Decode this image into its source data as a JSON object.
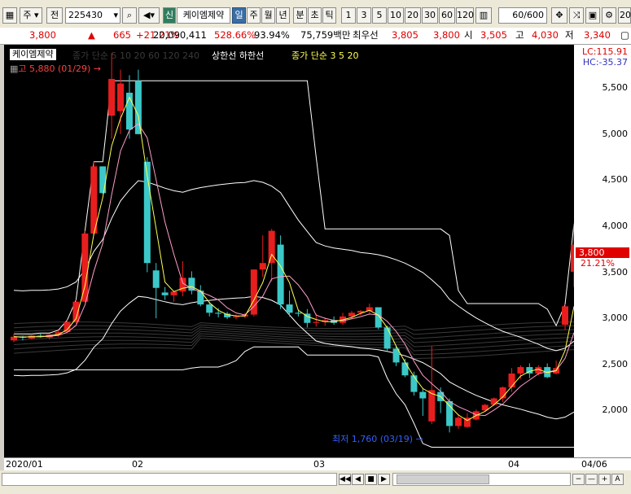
{
  "toolbar": {
    "market": "주",
    "prev_label": "전",
    "code": "225430",
    "badge": "신",
    "name": "케이엠제약",
    "periods": [
      "일",
      "주",
      "월",
      "년",
      "분",
      "초",
      "틱"
    ],
    "active_period": "일",
    "intervals": [
      "1",
      "3",
      "5",
      "10",
      "20",
      "30",
      "60",
      "120"
    ],
    "count": "60",
    "count_total": "/600",
    "right_label": "20"
  },
  "info": {
    "price": "3,800",
    "change": "665",
    "change_pct": "+21.21%",
    "volume": "20,090,411",
    "vol_ratio": "528.66%",
    "ratio": "93.94%",
    "amount": "75,759백만",
    "bid_label": "최우선",
    "bid": "3,805",
    "ask": "3,800",
    "open_label": "시",
    "open": "3,505",
    "high_label": "고",
    "high": "4,030",
    "low_label": "저",
    "low": "3,340"
  },
  "chart": {
    "legend_name": "케이엠제약",
    "legend_faint": "종가 단순 5  10  20  60  120  240",
    "legend_bands": "상한선  하한선",
    "legend_ma": "종가 단순 3  5  20",
    "high_marker": "고 5,880 (01/29)",
    "low_marker": "최저 1,760 (03/19)",
    "lc": "LC:115.91",
    "hc": "HC:-35.37",
    "current_price": "3,800",
    "current_pct": "21.21%"
  },
  "colors": {
    "up": "#e81e1e",
    "down": "#3cc8c8",
    "ma3": "#ffff50",
    "ma5": "#ff9ec8",
    "band": "#ffffff"
  },
  "chart_data": {
    "type": "candlestick",
    "y_ticks": [
      "5,500",
      "5,000",
      "4,500",
      "4,000",
      "3,500",
      "3,000",
      "2,500",
      "2,000"
    ],
    "x_ticks": [
      "2020/01",
      "02",
      "03",
      "04",
      "04/06"
    ],
    "candles": [
      {
        "o": 2760,
        "h": 2830,
        "l": 2740,
        "c": 2800
      },
      {
        "o": 2800,
        "h": 2810,
        "l": 2760,
        "c": 2790
      },
      {
        "o": 2780,
        "h": 2830,
        "l": 2770,
        "c": 2810
      },
      {
        "o": 2810,
        "h": 2840,
        "l": 2790,
        "c": 2800
      },
      {
        "o": 2790,
        "h": 2830,
        "l": 2770,
        "c": 2820
      },
      {
        "o": 2820,
        "h": 2870,
        "l": 2800,
        "c": 2850
      },
      {
        "o": 2850,
        "h": 2980,
        "l": 2840,
        "c": 2960
      },
      {
        "o": 2960,
        "h": 3200,
        "l": 2940,
        "c": 3180
      },
      {
        "o": 3180,
        "h": 3950,
        "l": 3170,
        "c": 3920
      },
      {
        "o": 3920,
        "h": 4700,
        "l": 3900,
        "c": 4650
      },
      {
        "o": 4650,
        "h": 4360,
        "l": 4350,
        "c": 4360
      },
      {
        "o": 5200,
        "h": 5880,
        "l": 4950,
        "c": 5600
      },
      {
        "o": 5250,
        "h": 5700,
        "l": 5000,
        "c": 5550
      },
      {
        "o": 5450,
        "h": 5640,
        "l": 4950,
        "c": 5050
      },
      {
        "o": 5580,
        "h": 5700,
        "l": 5300,
        "c": 5000
      },
      {
        "o": 4700,
        "h": 4750,
        "l": 3500,
        "c": 3600
      },
      {
        "o": 3520,
        "h": 3600,
        "l": 3000,
        "c": 3330
      },
      {
        "o": 3280,
        "h": 3340,
        "l": 3200,
        "c": 3250
      },
      {
        "o": 3250,
        "h": 3300,
        "l": 3180,
        "c": 3290
      },
      {
        "o": 3290,
        "h": 3620,
        "l": 3240,
        "c": 3440
      },
      {
        "o": 3440,
        "h": 3510,
        "l": 3260,
        "c": 3300
      },
      {
        "o": 3300,
        "h": 3360,
        "l": 3130,
        "c": 3150
      },
      {
        "o": 3150,
        "h": 3180,
        "l": 3020,
        "c": 3060
      },
      {
        "o": 3060,
        "h": 3110,
        "l": 3010,
        "c": 3050
      },
      {
        "o": 3050,
        "h": 3070,
        "l": 2990,
        "c": 3010
      },
      {
        "o": 3010,
        "h": 3040,
        "l": 2990,
        "c": 3020
      },
      {
        "o": 3020,
        "h": 3060,
        "l": 3000,
        "c": 3040
      },
      {
        "o": 3040,
        "h": 3500,
        "l": 3020,
        "c": 3530
      },
      {
        "o": 3530,
        "h": 3900,
        "l": 3450,
        "c": 3600
      },
      {
        "o": 3600,
        "h": 3970,
        "l": 3400,
        "c": 3950
      },
      {
        "o": 3800,
        "h": 3900,
        "l": 3100,
        "c": 3150
      },
      {
        "o": 3150,
        "h": 3300,
        "l": 3020,
        "c": 3060
      },
      {
        "o": 3060,
        "h": 3090,
        "l": 3020,
        "c": 3050
      },
      {
        "o": 3050,
        "h": 3100,
        "l": 2900,
        "c": 2950
      },
      {
        "o": 2950,
        "h": 3050,
        "l": 2910,
        "c": 2960
      },
      {
        "o": 2960,
        "h": 3010,
        "l": 2920,
        "c": 2980
      },
      {
        "o": 2980,
        "h": 3020,
        "l": 2930,
        "c": 2950
      },
      {
        "o": 2950,
        "h": 3060,
        "l": 2930,
        "c": 3020
      },
      {
        "o": 3020,
        "h": 3080,
        "l": 3000,
        "c": 3060
      },
      {
        "o": 3060,
        "h": 3090,
        "l": 3030,
        "c": 3080
      },
      {
        "o": 3080,
        "h": 3160,
        "l": 3040,
        "c": 3120
      },
      {
        "o": 3120,
        "h": 3100,
        "l": 2880,
        "c": 2900
      },
      {
        "o": 2900,
        "h": 2920,
        "l": 2650,
        "c": 2670
      },
      {
        "o": 2670,
        "h": 2700,
        "l": 2480,
        "c": 2520
      },
      {
        "o": 2520,
        "h": 2560,
        "l": 2360,
        "c": 2380
      },
      {
        "o": 2380,
        "h": 2420,
        "l": 2160,
        "c": 2200
      },
      {
        "o": 2200,
        "h": 2240,
        "l": 1940,
        "c": 2130
      },
      {
        "o": 1880,
        "h": 2700,
        "l": 1850,
        "c": 2220
      },
      {
        "o": 2200,
        "h": 2250,
        "l": 1970,
        "c": 2100
      },
      {
        "o": 2100,
        "h": 2130,
        "l": 1760,
        "c": 1830
      },
      {
        "o": 1830,
        "h": 1960,
        "l": 1800,
        "c": 1920
      },
      {
        "o": 1820,
        "h": 1970,
        "l": 1810,
        "c": 1920
      },
      {
        "o": 1900,
        "h": 2010,
        "l": 1890,
        "c": 1990
      },
      {
        "o": 2000,
        "h": 2070,
        "l": 1990,
        "c": 2060
      },
      {
        "o": 2060,
        "h": 2140,
        "l": 2050,
        "c": 2130
      },
      {
        "o": 2130,
        "h": 2260,
        "l": 2090,
        "c": 2250
      },
      {
        "o": 2250,
        "h": 2460,
        "l": 2200,
        "c": 2400
      },
      {
        "o": 2400,
        "h": 2490,
        "l": 2340,
        "c": 2470
      },
      {
        "o": 2470,
        "h": 2510,
        "l": 2350,
        "c": 2400
      },
      {
        "o": 2400,
        "h": 2490,
        "l": 2380,
        "c": 2470
      },
      {
        "o": 2470,
        "h": 2510,
        "l": 2350,
        "c": 2360
      },
      {
        "o": 2400,
        "h": 2540,
        "l": 2390,
        "c": 2460
      },
      {
        "o": 2930,
        "h": 3150,
        "l": 2870,
        "c": 3130
      },
      {
        "o": 3505,
        "h": 4030,
        "l": 3340,
        "c": 3800
      }
    ],
    "ylim": [
      1560,
      5900
    ]
  }
}
